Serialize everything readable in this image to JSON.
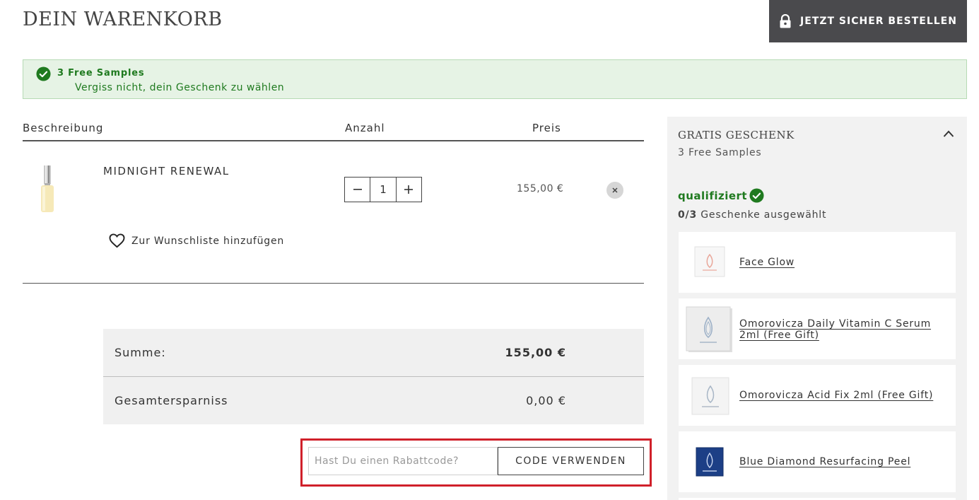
{
  "header": {
    "title": "DEIN WARENKORB",
    "checkout_label": "JETZT SICHER BESTELLEN"
  },
  "notice": {
    "title": "3 Free Samples",
    "text": "Vergiss nicht, dein Geschenk zu wählen"
  },
  "cart": {
    "columns": [
      "Beschreibung",
      "Anzahl",
      "Preis"
    ],
    "items": [
      {
        "name": "MIDNIGHT RENEWAL",
        "quantity": "1",
        "price": "155,00 €",
        "wishlist_label": "Zur Wunschliste hinzufügen"
      }
    ]
  },
  "totals": {
    "sum_label": "Summe:",
    "sum_value": "155,00 €",
    "savings_label": "Gesamtersparniss",
    "savings_value": "0,00 €"
  },
  "promo": {
    "placeholder": "Hast Du einen Rabattcode?",
    "button_label": "CODE VERWENDEN"
  },
  "gift_panel": {
    "title": "GRATIS GESCHENK",
    "subtitle": "3 Free Samples",
    "qualified_label": "qualifiziert",
    "selected_count": "0/3",
    "selected_text": "Geschenke ausgewählt",
    "gifts": [
      {
        "label": "Face Glow"
      },
      {
        "label": "Omorovicza Daily Vitamin C Serum 2ml (Free Gift)"
      },
      {
        "label": "Omorovicza Acid Fix 2ml (Free Gift)"
      },
      {
        "label": "Blue Diamond Resurfacing Peel"
      }
    ]
  },
  "colors": {
    "checkout_bg": "#4a4a4d",
    "success_green": "#1f7a1f",
    "notice_bg": "#e6f3e5",
    "highlight_red": "#d0202a",
    "panel_bg": "#f2f2f2"
  }
}
